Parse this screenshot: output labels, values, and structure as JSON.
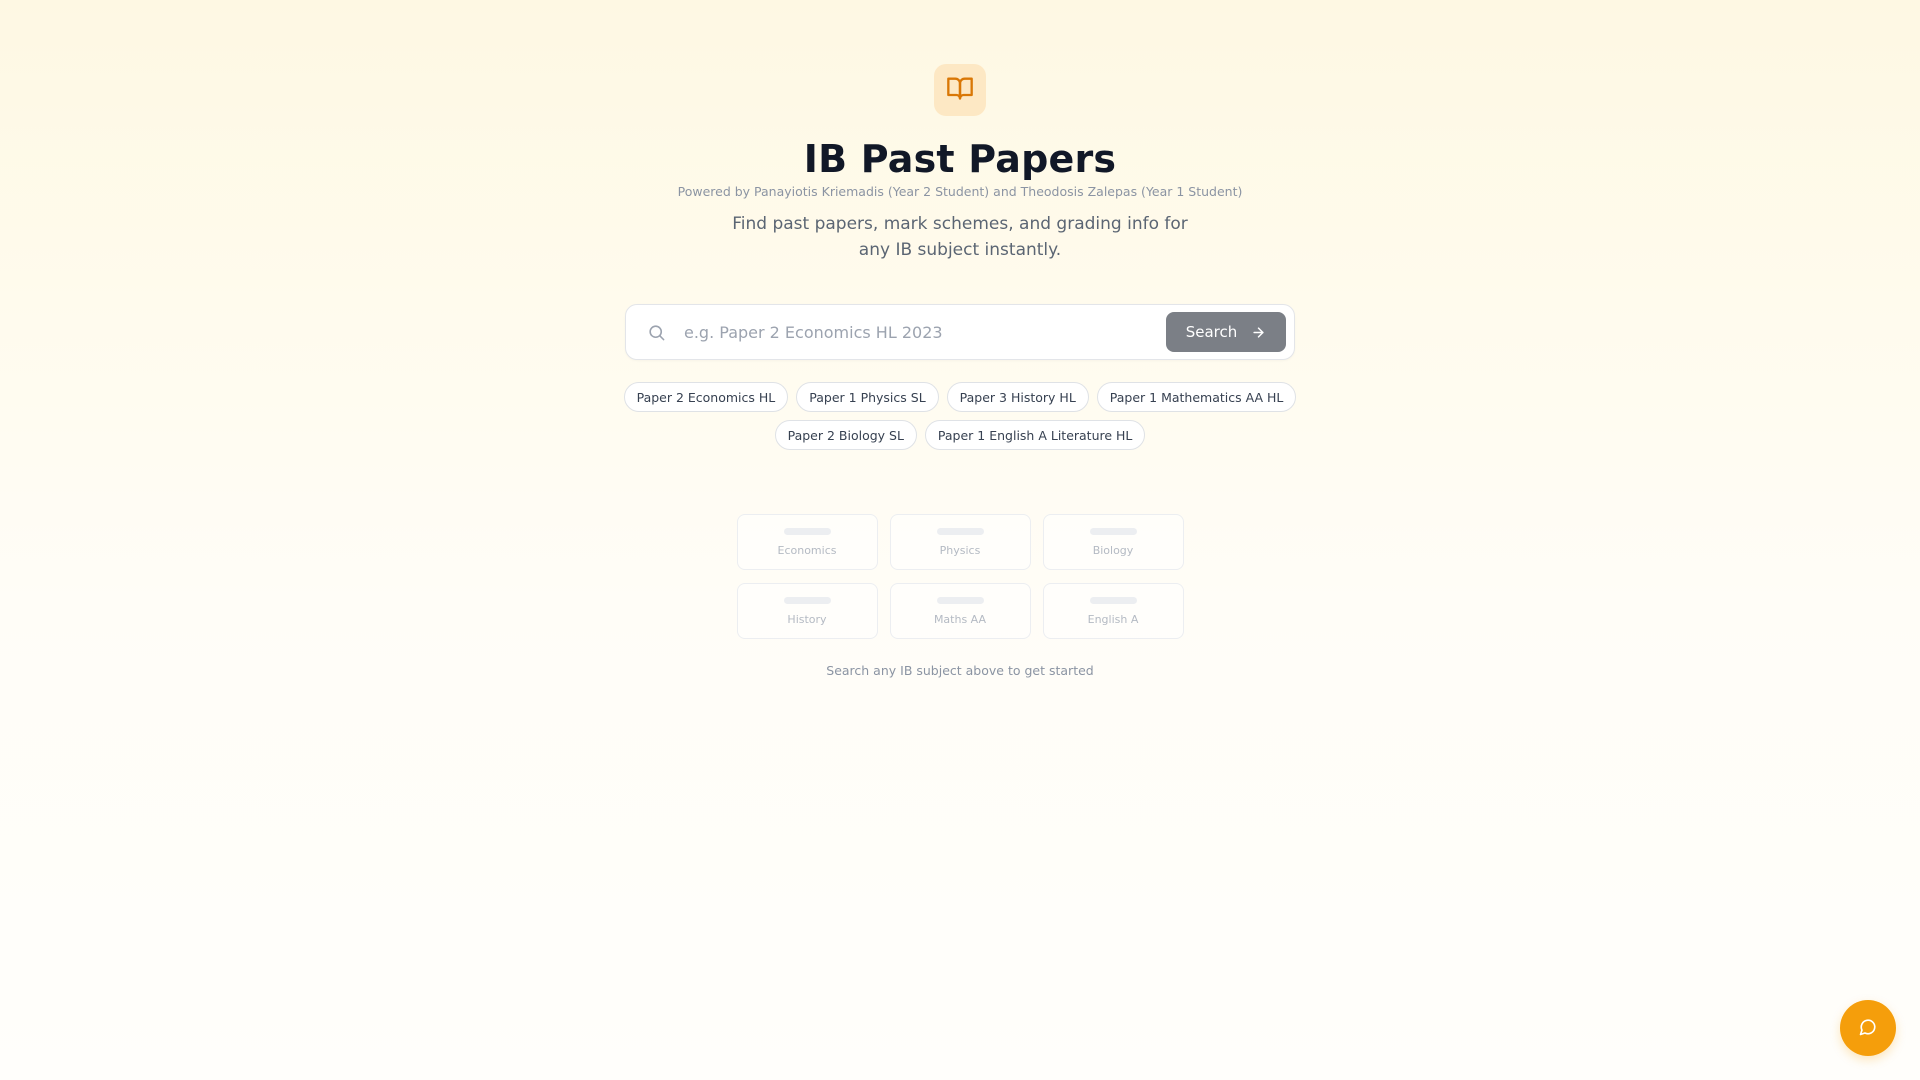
{
  "header": {
    "logo_icon": "open-book-icon",
    "title": "IB Past Papers",
    "powered_by": "Powered by Panayiotis Kriemadis (Year 2 Student) and Theodosis Zalepas (Year 1 Student)",
    "tagline": "Find past papers, mark schemes, and grading info for any IB subject instantly."
  },
  "search": {
    "icon": "search-icon",
    "placeholder": "e.g. Paper 2 Economics HL 2023",
    "value": "",
    "button_label": "Search",
    "button_icon": "arrow-right-icon"
  },
  "suggestions": [
    "Paper 2 Economics HL",
    "Paper 1 Physics SL",
    "Paper 3 History HL",
    "Paper 1 Mathematics AA HL",
    "Paper 2 Biology SL",
    "Paper 1 English A Literature HL"
  ],
  "subjects": [
    "Economics",
    "Physics",
    "Biology",
    "History",
    "Maths AA",
    "English A"
  ],
  "hint": "Search any IB subject above to get started",
  "chat": {
    "icon": "chat-bubble-icon"
  },
  "colors": {
    "accent": "#f59e0b",
    "logo_tile": "#fde8c4",
    "search_button": "#7b7f86",
    "title": "#111827"
  }
}
